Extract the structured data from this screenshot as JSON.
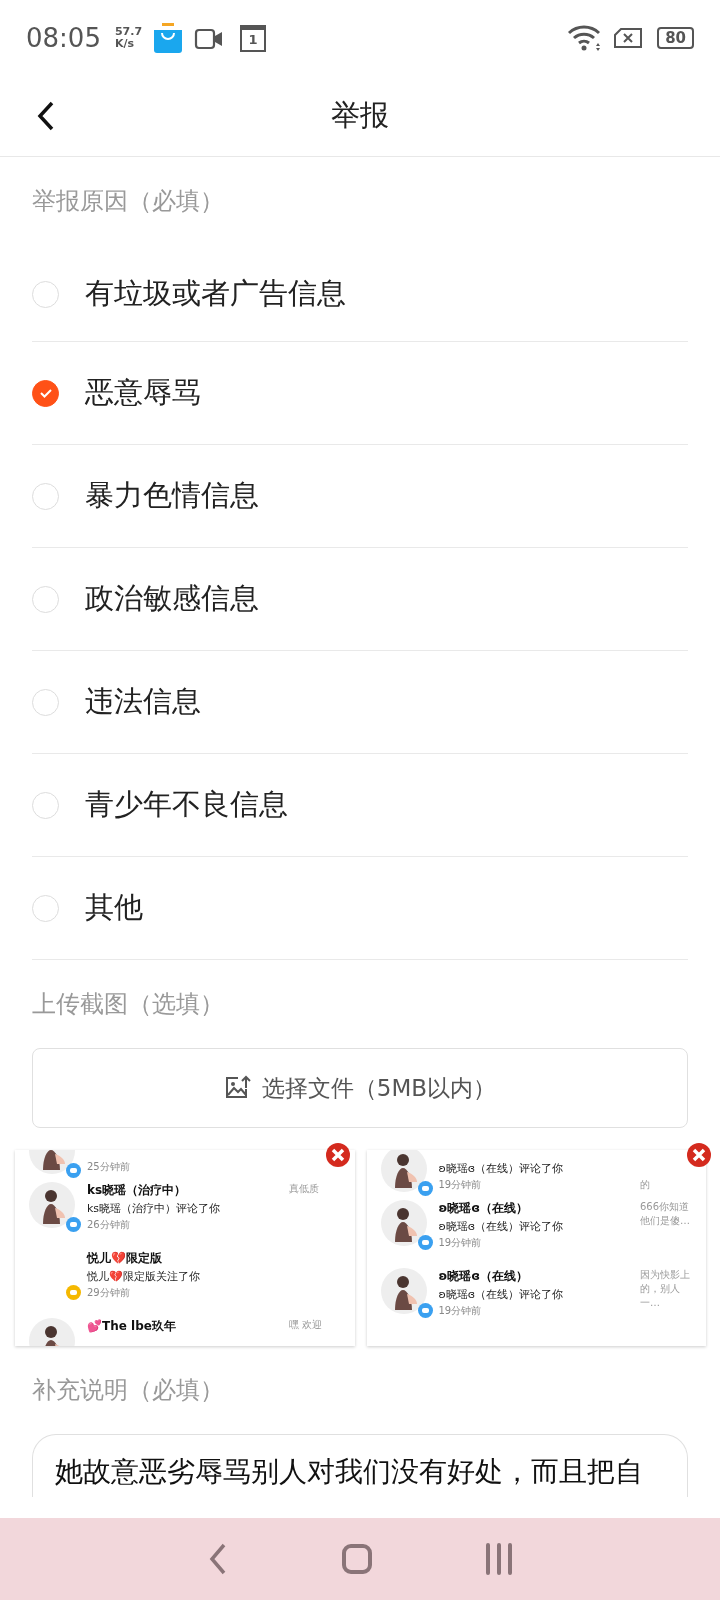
{
  "status_bar": {
    "time": "08:05",
    "speed": "57.7",
    "speed_unit": "K/s",
    "calendar_day": "1",
    "battery": "80"
  },
  "header": {
    "title": "举报"
  },
  "reason": {
    "label": "举报原因（必填）",
    "options": [
      {
        "label": "有垃圾或者广告信息",
        "selected": false
      },
      {
        "label": "恶意辱骂",
        "selected": true
      },
      {
        "label": "暴力色情信息",
        "selected": false
      },
      {
        "label": "政治敏感信息",
        "selected": false
      },
      {
        "label": "违法信息",
        "selected": false
      },
      {
        "label": "青少年不良信息",
        "selected": false
      },
      {
        "label": "其他",
        "selected": false
      }
    ]
  },
  "upload": {
    "label": "上传截图（选填）",
    "button": "选择文件（5MB以内）"
  },
  "screenshots": [
    {
      "rows": [
        {
          "kind": "comment",
          "avatar": true,
          "time": "25分钟前"
        },
        {
          "kind": "comment",
          "avatar": true,
          "name": "ks晓瑶（治疗中）",
          "action": "ks晓瑶（治疗中）评论了你",
          "time": "26分钟前",
          "note": "真低质"
        },
        {
          "kind": "follow",
          "avatar": false,
          "name": "悦儿💔限定版",
          "action": "悦儿💔限定版关注了你",
          "time": "29分钟前"
        },
        {
          "kind": "none",
          "avatar": true,
          "name": "💕The lbe玖年",
          "note": "嘿 欢迎"
        }
      ]
    },
    {
      "rows": [
        {
          "kind": "comment",
          "avatar": true,
          "action": "ʚ晓瑶ɞ（在线）评论了你",
          "time": "19分钟前",
          "note": "的"
        },
        {
          "kind": "comment",
          "avatar": true,
          "name": "ʚ晓瑶ɞ（在线）",
          "action": "ʚ晓瑶ɞ（在线）评论了你",
          "time": "19分钟前",
          "note": "666你知道他们是傻…"
        },
        {
          "kind": "comment",
          "avatar": true,
          "name": "ʚ晓瑶ɞ（在线）",
          "action": "ʚ晓瑶ɞ（在线）评论了你",
          "time": "19分钟前",
          "note": "因为快影上的，别人一…"
        }
      ]
    }
  ],
  "details": {
    "label": "补充说明（必填）",
    "value": "她故意恶劣辱骂别人对我们没有好处，而且把自"
  }
}
